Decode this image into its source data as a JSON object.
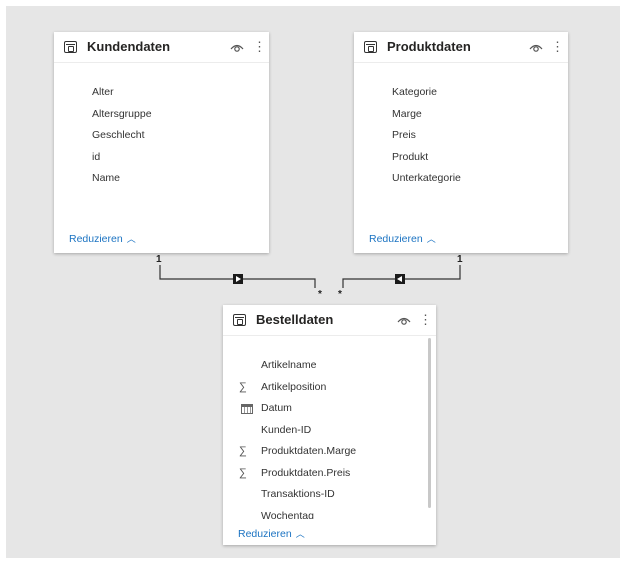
{
  "tables": {
    "kundendaten": {
      "title": "Kundendaten",
      "fields": [
        "Alter",
        "Altersgruppe",
        "Geschlecht",
        "id",
        "Name"
      ],
      "collapse_label": "Reduzieren"
    },
    "produktdaten": {
      "title": "Produktdaten",
      "fields": [
        "Kategorie",
        "Marge",
        "Preis",
        "Produkt",
        "Unterkategorie"
      ],
      "collapse_label": "Reduzieren"
    },
    "bestelldaten": {
      "title": "Bestelldaten",
      "fields": [
        {
          "label": "Artikelname",
          "icon": ""
        },
        {
          "label": "Artikelposition",
          "icon": "sigma-icon"
        },
        {
          "label": "Datum",
          "icon": "calendar-icon"
        },
        {
          "label": "Kunden-ID",
          "icon": ""
        },
        {
          "label": "Produktdaten.Marge",
          "icon": "sigma-icon"
        },
        {
          "label": "Produktdaten.Preis",
          "icon": "sigma-icon"
        },
        {
          "label": "Transaktions-ID",
          "icon": ""
        },
        {
          "label": "Wochentag",
          "icon": ""
        }
      ],
      "collapse_label": "Reduzieren"
    }
  },
  "relationships": [
    {
      "from": "Kundendaten",
      "to": "Bestelldaten",
      "from_cardinality": "1",
      "to_cardinality": "*"
    },
    {
      "from": "Produktdaten",
      "to": "Bestelldaten",
      "from_cardinality": "1",
      "to_cardinality": "*"
    }
  ],
  "colors": {
    "canvas": "#e6e6e6",
    "link": "#1b73c2",
    "line": "#333333"
  }
}
